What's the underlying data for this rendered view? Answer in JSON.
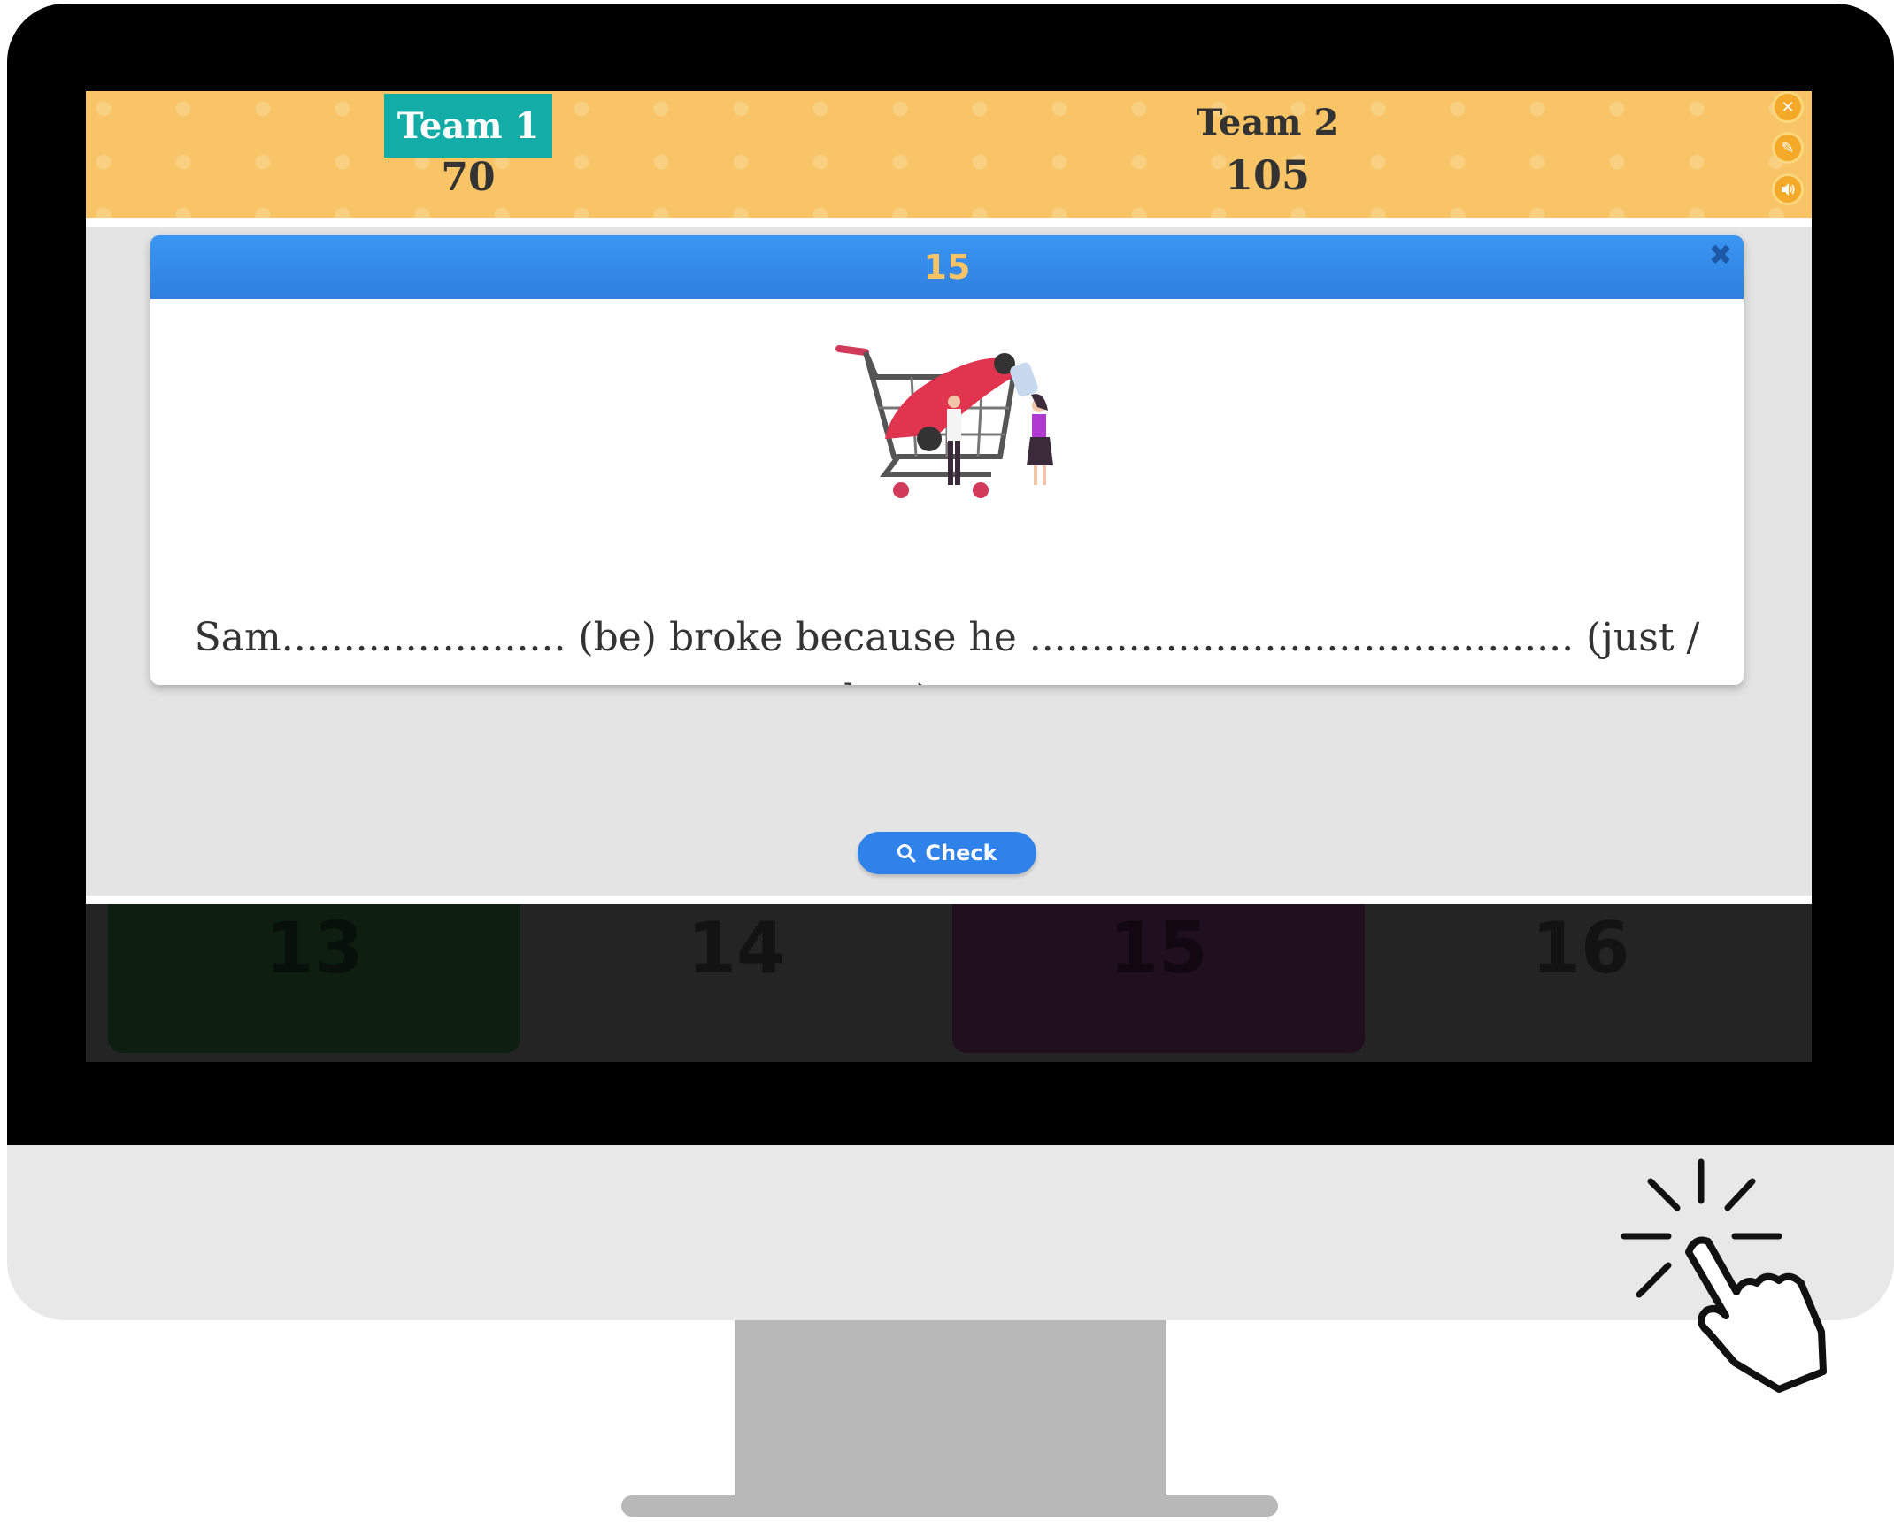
{
  "scoreboard": {
    "team1": {
      "name": "Team 1",
      "score": "70"
    },
    "team2": {
      "name": "Team 2",
      "score": "105"
    },
    "buttons": [
      {
        "icon": "close-icon",
        "glyph": "✕"
      },
      {
        "icon": "pencil-icon",
        "glyph": "✎"
      },
      {
        "icon": "speaker-icon",
        "glyph": "🔈"
      }
    ]
  },
  "modal": {
    "number": "15",
    "close_glyph": "✖",
    "question": "Sam....................... (be) broke because he ............................................ (just / buy) a car."
  },
  "check_button": {
    "label": "Check",
    "icon": "search-icon"
  },
  "tiles": [
    {
      "label": "13",
      "color": "#0e1f12"
    },
    {
      "label": "14",
      "color": "#242424"
    },
    {
      "label": "15",
      "color": "#200f1f"
    },
    {
      "label": "16",
      "color": "#242424"
    }
  ],
  "colors": {
    "topbar": "#f8c465",
    "team1_tag": "#14aca6",
    "modal_header": "#3a96f3",
    "check_button": "#2f82ea"
  }
}
